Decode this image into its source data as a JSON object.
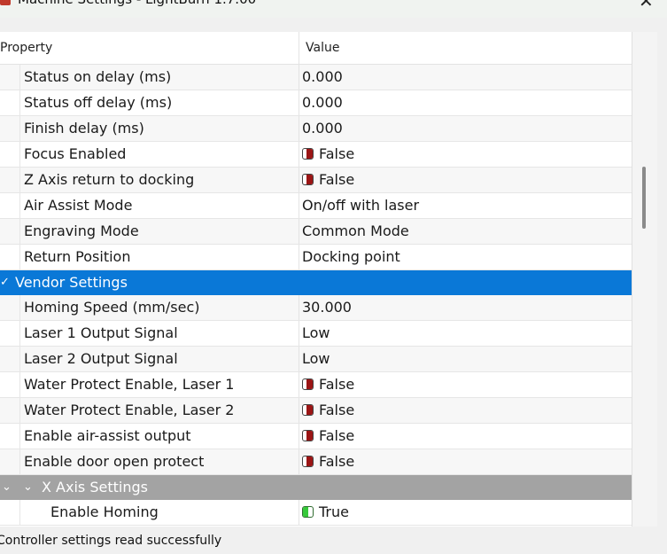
{
  "window": {
    "title": "Machine Settings - LightBurn 1.7.00"
  },
  "table": {
    "header_property": "Property",
    "header_value": "Value"
  },
  "rows_top": [
    {
      "label": "Status on delay (ms)",
      "value": "0.000"
    },
    {
      "label": "Status off delay (ms)",
      "value": "0.000"
    },
    {
      "label": "Finish delay (ms)",
      "value": "0.000"
    },
    {
      "label": "Focus Enabled",
      "value": "False"
    },
    {
      "label": "Z Axis return to docking",
      "value": "False"
    },
    {
      "label": "Air Assist Mode",
      "value": "On/off with laser"
    },
    {
      "label": "Engraving Mode",
      "value": "Common Mode"
    },
    {
      "label": "Return Position",
      "value": "Docking point"
    }
  ],
  "vendor_category": {
    "label": "Vendor Settings",
    "expanded": true,
    "color": "#0a78d7"
  },
  "rows_vendor": [
    {
      "label": "Homing Speed (mm/sec)",
      "value": "30.000"
    },
    {
      "label": "Laser 1 Output Signal",
      "value": "Low"
    },
    {
      "label": "Laser 2 Output Signal",
      "value": "Low"
    },
    {
      "label": "Water Protect Enable, Laser 1",
      "value": "False"
    },
    {
      "label": "Water Protect Enable, Laser 2",
      "value": "False"
    },
    {
      "label": "Enable air-assist output",
      "value": "False"
    },
    {
      "label": "Enable door open protect",
      "value": "False"
    }
  ],
  "xaxis_category": {
    "label": "X Axis Settings",
    "expanded": true,
    "color": "#a3a3a3"
  },
  "rows_xaxis": [
    {
      "label": "Enable Homing",
      "value": "True"
    }
  ],
  "status_bar": {
    "message": "Controller settings read successfully"
  },
  "icons": {
    "toggle_false": "toggle-off-icon",
    "toggle_true": "toggle-on-icon",
    "chevron": "chevron-down-icon",
    "close": "close-icon"
  }
}
